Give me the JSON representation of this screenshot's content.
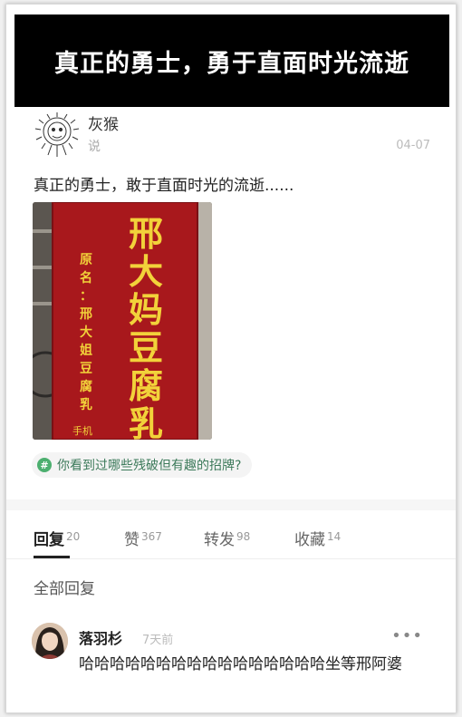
{
  "banner": {
    "text": "真正的勇士，勇于直面时光流逝"
  },
  "post": {
    "author": "灰猴",
    "subtitle": "说",
    "date": "04-07",
    "text": "真正的勇士，敢于直面时光的流逝......",
    "photo_sign": {
      "big_chars": [
        "邢",
        "大",
        "妈",
        "豆",
        "腐",
        "乳"
      ],
      "small_chars": [
        "原",
        "名",
        "：",
        "邢",
        "大",
        "姐",
        "豆",
        "腐",
        "乳"
      ],
      "phone_label": "手机"
    },
    "topic": {
      "icon": "hash-icon",
      "text": "你看到过哪些残破但有趣的招牌?"
    }
  },
  "tabs": [
    {
      "label": "回复",
      "count": "20"
    },
    {
      "label": "赞",
      "count": "367"
    },
    {
      "label": "转发",
      "count": "98"
    },
    {
      "label": "收藏",
      "count": "14"
    }
  ],
  "replies_header": "全部回复",
  "reply": {
    "name": "落羽杉",
    "time": "7天前",
    "more": "•••",
    "text": "哈哈哈哈哈哈哈哈哈哈哈哈哈哈哈哈坐等邢阿婆"
  },
  "colors": {
    "banner_bg": "#000000",
    "sign_red": "#a8181c",
    "sign_gold": "#f2d23a",
    "topic_green": "#4caf6f"
  }
}
